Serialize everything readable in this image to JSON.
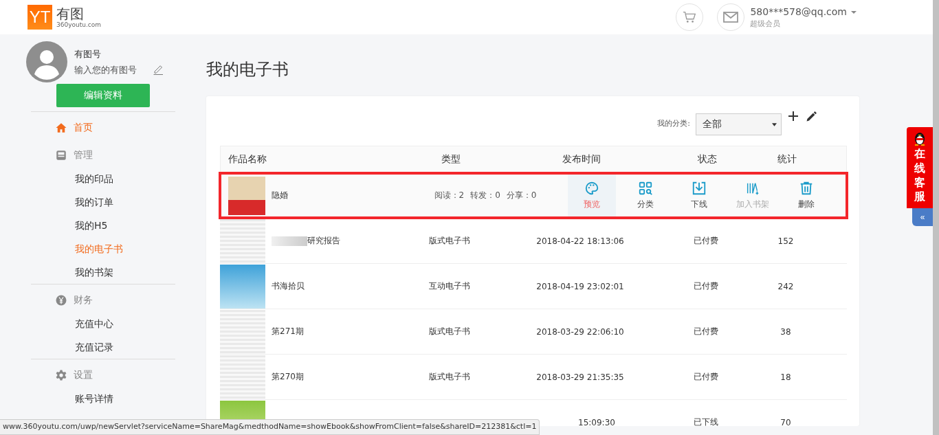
{
  "header": {
    "logo_mark": "YT",
    "logo_text": "有图",
    "logo_domain": "360youtu.com",
    "user": {
      "email": "580***578@qq.com",
      "level": "超级会员"
    }
  },
  "profile": {
    "name": "有图号",
    "id_placeholder": "输入您的有图号",
    "edit_button": "编辑资料"
  },
  "sidebar": {
    "groups": [
      [
        {
          "title": "首页",
          "selected": true
        },
        {
          "title": "管理",
          "selected": false,
          "items": [
            {
              "label": "我的印品",
              "selected": false
            },
            {
              "label": "我的订单",
              "selected": false
            },
            {
              "label": "我的H5",
              "selected": false
            },
            {
              "label": "我的电子书",
              "selected": true
            },
            {
              "label": "我的书架",
              "selected": false
            }
          ]
        }
      ],
      [
        {
          "title": "财务",
          "selected": false,
          "items": [
            {
              "label": "充值中心",
              "selected": false
            },
            {
              "label": "充值记录",
              "selected": false
            }
          ]
        }
      ],
      [
        {
          "title": "设置",
          "selected": false,
          "items": [
            {
              "label": "账号详情",
              "selected": false
            }
          ]
        }
      ]
    ]
  },
  "page_title": "我的电子书",
  "filter": {
    "label": "我的分类:",
    "value": "全部"
  },
  "table": {
    "columns": [
      "作品名称",
      "类型",
      "发布时间",
      "状态",
      "统计"
    ],
    "rows": [
      {
        "kind": "actions",
        "name": "隐婚",
        "stats": [
          "阅读：2",
          "转发：0",
          "分享：0"
        ],
        "actions": [
          {
            "label": "预览",
            "selected": true,
            "disabled": false
          },
          {
            "label": "分类",
            "selected": false,
            "disabled": false
          },
          {
            "label": "下线",
            "selected": false,
            "disabled": false
          },
          {
            "label": "加入书架",
            "selected": false,
            "disabled": true
          },
          {
            "label": "删除",
            "selected": false,
            "disabled": false
          }
        ]
      },
      {
        "kind": "data",
        "name": "研究报告",
        "blurred": true,
        "type": "版式电子书",
        "date": "2018-04-22 18:13:06",
        "status": "已付费",
        "count": "152"
      },
      {
        "kind": "data",
        "name": "书海拾贝",
        "blurred": false,
        "type": "互动电子书",
        "date": "2018-04-19 23:02:01",
        "status": "已付费",
        "count": "242"
      },
      {
        "kind": "data",
        "name": "第271期",
        "blurred": false,
        "type": "版式电子书",
        "date": "2018-03-29 22:06:10",
        "status": "已付费",
        "count": "38"
      },
      {
        "kind": "data",
        "name": "第270期",
        "blurred": false,
        "type": "版式电子书",
        "date": "2018-03-29 21:35:35",
        "status": "已付费",
        "count": "18"
      },
      {
        "kind": "data",
        "blurred": false,
        "date": "15:09:30",
        "status": "已下线",
        "count": "70"
      }
    ]
  },
  "status_url": "www.360youtu.com/uwp/newServlet?serviceName=ShareMag&medthodName=showEbook&showFromClient=false&shareID=212381&ctl=1",
  "chat_widget": {
    "label": "在线客服",
    "collapse": "«"
  }
}
